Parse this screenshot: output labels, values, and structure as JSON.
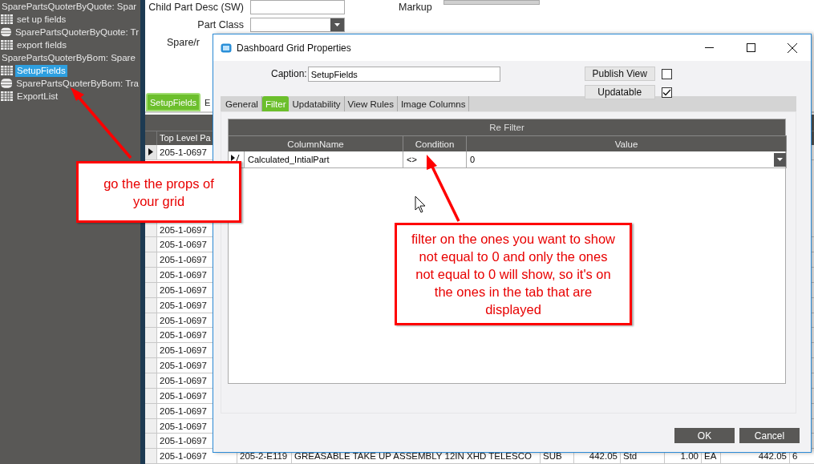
{
  "sidebar": {
    "groups": [
      {
        "label": "SparePartsQuoterByQuote: Spar",
        "children": [
          {
            "label": "set up fields",
            "kind": "grid",
            "selected": false
          },
          {
            "label": "SparePartsQuoterByQuote: Tr",
            "kind": "view",
            "selected": false
          },
          {
            "label": "export fields",
            "kind": "grid",
            "selected": false
          }
        ]
      },
      {
        "label": "SparePartsQuoterByBom: Spare",
        "children": [
          {
            "label": "SetupFields",
            "kind": "grid",
            "selected": true
          },
          {
            "label": "SparePartsQuoterByBom: Tra",
            "kind": "view",
            "selected": false
          },
          {
            "label": "ExportList",
            "kind": "grid",
            "selected": false
          }
        ]
      }
    ]
  },
  "form": {
    "fields": [
      {
        "label": "Child Part Desc (SW)",
        "kind": "text"
      },
      {
        "label": "Part Class",
        "kind": "combo"
      },
      {
        "label": "Spare/r",
        "kind": "label"
      }
    ],
    "markup": {
      "label": "Markup"
    }
  },
  "tabs": [
    {
      "label": "SetupFields",
      "selected": true
    },
    {
      "label": "E",
      "selected": false
    }
  ],
  "grid": {
    "columns": [
      {
        "label": "Top Level Pa"
      }
    ],
    "rows": [
      {
        "current": true,
        "cells": [
          "205-1-0697"
        ]
      },
      {
        "current": false,
        "cells": [
          "205-1-0697"
        ]
      },
      {
        "current": false,
        "cells": [
          "205-1-0697"
        ]
      },
      {
        "current": false,
        "cells": [
          "205-1-0697"
        ]
      },
      {
        "current": false,
        "cells": [
          "205-1-0697"
        ]
      },
      {
        "current": false,
        "cells": [
          "205-1-0697"
        ]
      },
      {
        "current": false,
        "cells": [
          "205-1-0697"
        ]
      },
      {
        "current": false,
        "cells": [
          "205-1-0697"
        ]
      },
      {
        "current": false,
        "cells": [
          "205-1-0697"
        ]
      },
      {
        "current": false,
        "cells": [
          "205-1-0697"
        ]
      },
      {
        "current": false,
        "cells": [
          "205-1-0697"
        ]
      },
      {
        "current": false,
        "cells": [
          "205-1-0697"
        ]
      },
      {
        "current": false,
        "cells": [
          "205-1-0697"
        ]
      },
      {
        "current": false,
        "cells": [
          "205-1-0697"
        ]
      },
      {
        "current": false,
        "cells": [
          "205-1-0697"
        ]
      },
      {
        "current": false,
        "cells": [
          "205-1-0697"
        ]
      },
      {
        "current": false,
        "cells": [
          "205-1-0697",
          "205-2-E119",
          "GREASABLE TAKE UP ASSEMBLY 12IN XHD TELESCO",
          "SUB",
          "442.05",
          "Std",
          "1.00",
          "EA",
          "442.05",
          "6"
        ]
      }
    ]
  },
  "dialog": {
    "title": "Dashboard Grid Properties",
    "caption": {
      "label": "Caption:",
      "value": "SetupFields"
    },
    "options": [
      {
        "label": "Publish View",
        "checked": false
      },
      {
        "label": "Updatable",
        "checked": true
      }
    ],
    "tabs": [
      {
        "label": "General",
        "selected": false
      },
      {
        "label": "Filter",
        "selected": true
      },
      {
        "label": "Updatability",
        "selected": false
      },
      {
        "label": "View Rules",
        "selected": false
      },
      {
        "label": "Image Columns",
        "selected": false
      }
    ],
    "filter": {
      "title": "Re Filter",
      "columns": [
        "ColumnName",
        "Condition",
        "Value"
      ],
      "rows": [
        {
          "current": true,
          "cells": [
            "Calculated_IntialPart",
            "<>",
            "0"
          ]
        }
      ]
    },
    "buttons": [
      "OK",
      "Cancel"
    ]
  },
  "annotations": [
    {
      "text": "go the the props of your grid"
    },
    {
      "text": "filter on the ones you want to show not equal to 0 and only the ones not equal to 0 will show, so it's on the ones in the tab that are displayed"
    }
  ]
}
